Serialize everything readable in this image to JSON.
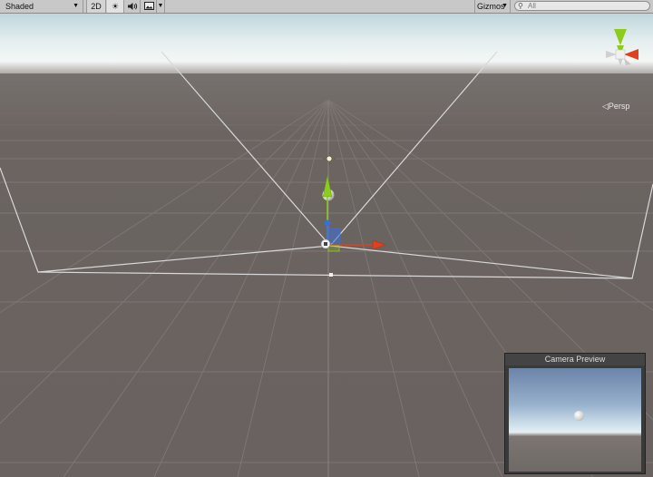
{
  "toolbar": {
    "shading_mode": "Shaded",
    "mode_2d_label": "2D",
    "lighting_icon": "sun-icon",
    "audio_icon": "speaker-icon",
    "effects_icon": "image-icon",
    "gizmos_label": "Gizmos",
    "search_placeholder": "All"
  },
  "scene": {
    "projection_label": "Persp",
    "axis_colors": {
      "x": "#e0401c",
      "y": "#8ccc1c",
      "z": "#3a6fd8"
    }
  },
  "camera_preview": {
    "title": "Camera Preview"
  },
  "colors": {
    "ground": "#6b6461",
    "sky_horizon": "#f2f5f5",
    "sky_top": "#b9d4d9",
    "grid_line": "#7a7371",
    "frustum": "#d7d7d7"
  }
}
